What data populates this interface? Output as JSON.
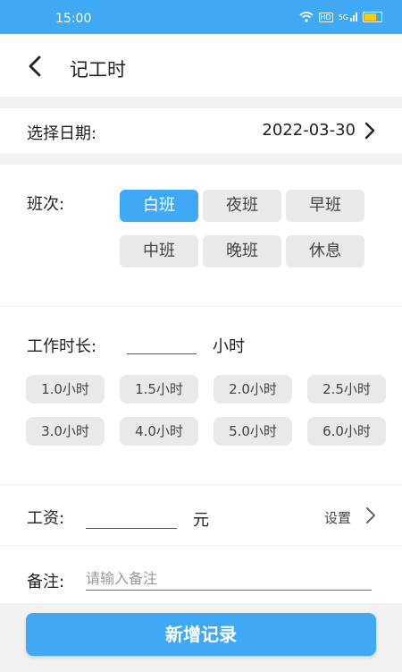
{
  "status": {
    "time": "15:00",
    "network_badge": "HD",
    "signal_text": "5G"
  },
  "header": {
    "title": "记工时"
  },
  "date": {
    "label": "选择日期:",
    "value": "2022-03-30"
  },
  "shift": {
    "label": "班次:",
    "options": [
      "白班",
      "夜班",
      "早班",
      "中班",
      "晚班",
      "休息"
    ],
    "selected": "白班"
  },
  "work": {
    "label": "工作时长:",
    "unit": "小时",
    "presets": [
      "1.0小时",
      "1.5小时",
      "2.0小时",
      "2.5小时",
      "3.0小时",
      "4.0小时",
      "5.0小时",
      "6.0小时"
    ]
  },
  "wage": {
    "label": "工资:",
    "unit": "元",
    "settings_label": "设置"
  },
  "note": {
    "label": "备注:",
    "placeholder": "请输入备注"
  },
  "submit": {
    "label": "新增记录"
  },
  "colors": {
    "accent": "#3fa9f5",
    "chip": "#e9e9e9",
    "battery": "#f5d000"
  }
}
